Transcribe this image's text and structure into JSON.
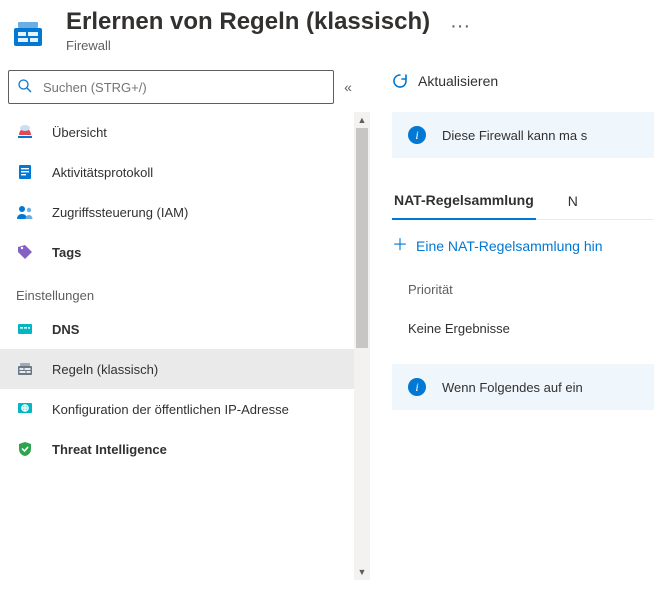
{
  "header": {
    "title": "Erlernen von Regeln (klassisch)",
    "subtitle": "Firewall",
    "more": "···"
  },
  "search": {
    "placeholder": "Suchen (STRG+/)",
    "collapse_glyph": "«"
  },
  "nav": {
    "items_top": [
      {
        "id": "overview",
        "label": "Übersicht"
      },
      {
        "id": "activity",
        "label": "Aktivitätsprotokoll"
      },
      {
        "id": "iam",
        "label": "Zugriffssteuerung (IAM)"
      },
      {
        "id": "tags",
        "label": "Tags"
      }
    ],
    "group_settings_label": "Einstellungen",
    "items_settings": [
      {
        "id": "dns",
        "label": "DNS"
      },
      {
        "id": "rules",
        "label": "Regeln (klassisch)"
      },
      {
        "id": "pubip",
        "label": "Konfiguration der öffentlichen IP-Adresse"
      },
      {
        "id": "threat",
        "label": "Threat Intelligence"
      }
    ]
  },
  "commands": {
    "refresh": "Aktualisieren"
  },
  "banner1": "Diese Firewall kann ma s",
  "tabs": {
    "nat": "NAT-Regelsammlung",
    "next": "N"
  },
  "add_nat": "Eine NAT-Regelsammlung hin",
  "col_priority": "Priorität",
  "no_results": "Keine Ergebnisse",
  "banner2": "Wenn Folgendes auf ein"
}
